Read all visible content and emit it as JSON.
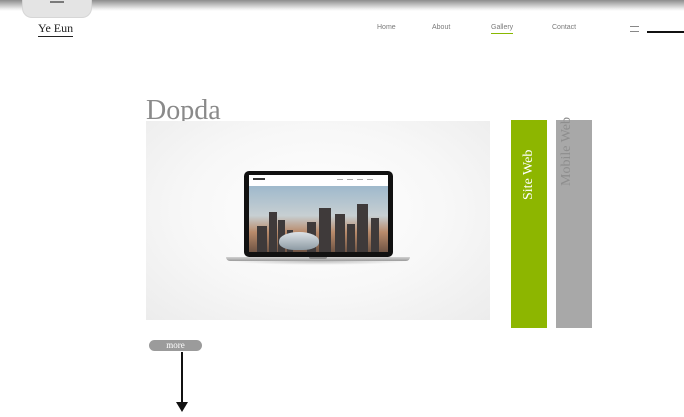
{
  "header": {
    "logo": "Ye Eun",
    "nav": [
      "Home",
      "About",
      "Gallery",
      "Contact"
    ],
    "active_nav": "Gallery"
  },
  "main": {
    "title": "Dopda",
    "tabs": [
      "Site Web",
      "Mobile Web"
    ],
    "more_label": "more"
  },
  "colors": {
    "accent": "#8db600",
    "inactive_tab": "#a8a8a8",
    "more_button": "#9b9b9b"
  },
  "icons": [
    "menu-icon",
    "down-arrow-icon"
  ]
}
